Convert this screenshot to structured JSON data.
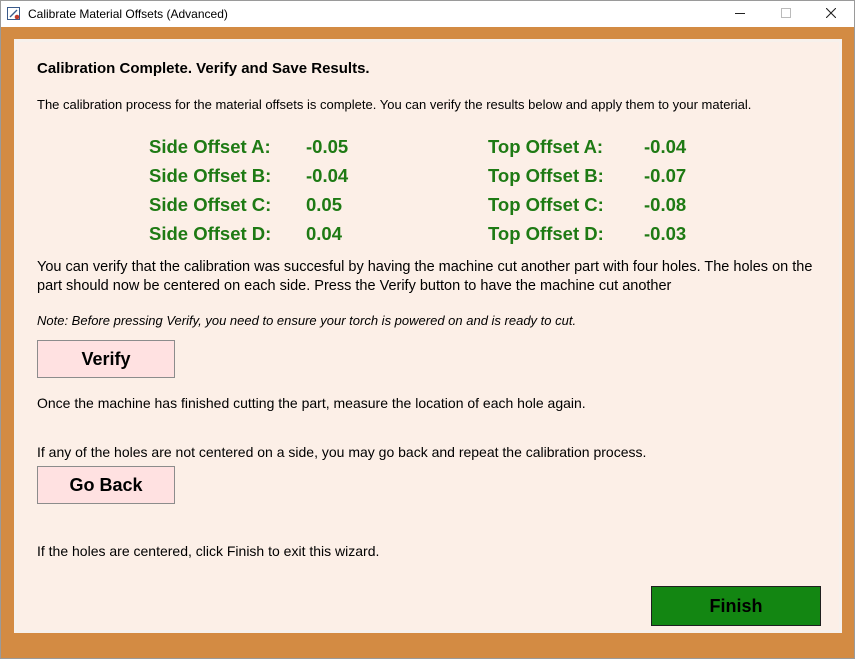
{
  "window": {
    "title": "Calibrate Material Offsets (Advanced)",
    "app_icon": "calibration-app-icon",
    "controls": {
      "minimize_icon": "minimize-icon",
      "maximize_icon": "maximize-icon",
      "close_icon": "close-icon"
    }
  },
  "content": {
    "heading": "Calibration Complete. Verify and Save Results.",
    "intro": "The calibration process for the material offsets is complete. You can verify the results below and apply them to your material.",
    "side_offsets": [
      {
        "label": "Side Offset A:",
        "value": "-0.05"
      },
      {
        "label": "Side Offset B:",
        "value": "-0.04"
      },
      {
        "label": "Side Offset C:",
        "value": "0.05"
      },
      {
        "label": "Side Offset D:",
        "value": "0.04"
      }
    ],
    "top_offsets": [
      {
        "label": "Top Offset A:",
        "value": "-0.04"
      },
      {
        "label": "Top Offset B:",
        "value": "-0.07"
      },
      {
        "label": "Top Offset C:",
        "value": "-0.08"
      },
      {
        "label": "Top Offset D:",
        "value": "-0.03"
      }
    ],
    "verify_text": "You can verify that the calibration was succesful by having the machine cut another part with four holes. The holes on the part should now be centered on each side. Press the Verify button to have the machine cut another",
    "note": "Note: Before pressing Verify, you need to ensure your torch is powered on and is ready to cut.",
    "verify_button": "Verify",
    "measure_text": "Once the machine has finished cutting the part, measure the location of each hole again.",
    "go_back_text": "If any of the holes are not centered on a side, you may go back and repeat the calibration process.",
    "go_back_button": "Go Back",
    "finish_text": "If the holes are centered, click Finish to exit this wizard.",
    "finish_button": "Finish"
  },
  "colors": {
    "frame": "#d38b43",
    "panel": "#fcefe7",
    "offset_text": "#1e7a14",
    "button_bg": "#ffe1e1",
    "finish_bg": "#138612"
  }
}
